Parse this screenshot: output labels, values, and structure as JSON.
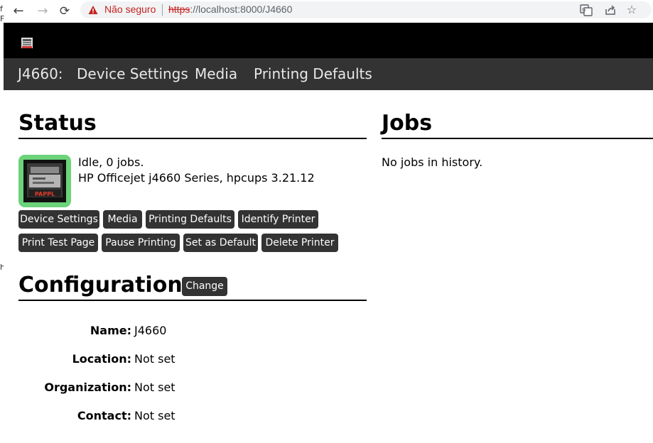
{
  "browser": {
    "security_label": "Não seguro",
    "url_scheme": "https",
    "url_rest": "://localhost:8000/J4660"
  },
  "nav": {
    "printer_name": "J4660:",
    "items": [
      "Device Settings",
      "Media",
      "Printing Defaults"
    ]
  },
  "status": {
    "heading": "Status",
    "state": "Idle, 0 jobs.",
    "driver": "HP Officejet j4660 Series, hpcups 3.21.12",
    "icon_label": "PAPPL",
    "buttons": [
      "Device Settings",
      "Media",
      "Printing Defaults",
      "Identify Printer",
      "Print Test Page",
      "Pause Printing",
      "Set as Default",
      "Delete Printer"
    ]
  },
  "jobs": {
    "heading": "Jobs",
    "empty_text": "No jobs in history."
  },
  "configuration": {
    "heading": "Configuration",
    "change_label": "Change",
    "rows": [
      {
        "label": "Name:",
        "value": "J4660"
      },
      {
        "label": "Location:",
        "value": "Not set"
      },
      {
        "label": "Organization:",
        "value": "Not set"
      },
      {
        "label": "Contact:",
        "value": "Not set"
      }
    ]
  },
  "colors": {
    "header_bg": "#000000",
    "nav_bg": "#333333",
    "button_bg": "#333333",
    "status_icon_bg": "#6cd37a",
    "warning": "#c5221f"
  },
  "icons": [
    "back-arrow-icon",
    "forward-arrow-icon",
    "reload-icon",
    "warning-icon",
    "translate-icon",
    "share-icon",
    "star-icon",
    "pappl-logo-icon",
    "printer-status-icon"
  ]
}
